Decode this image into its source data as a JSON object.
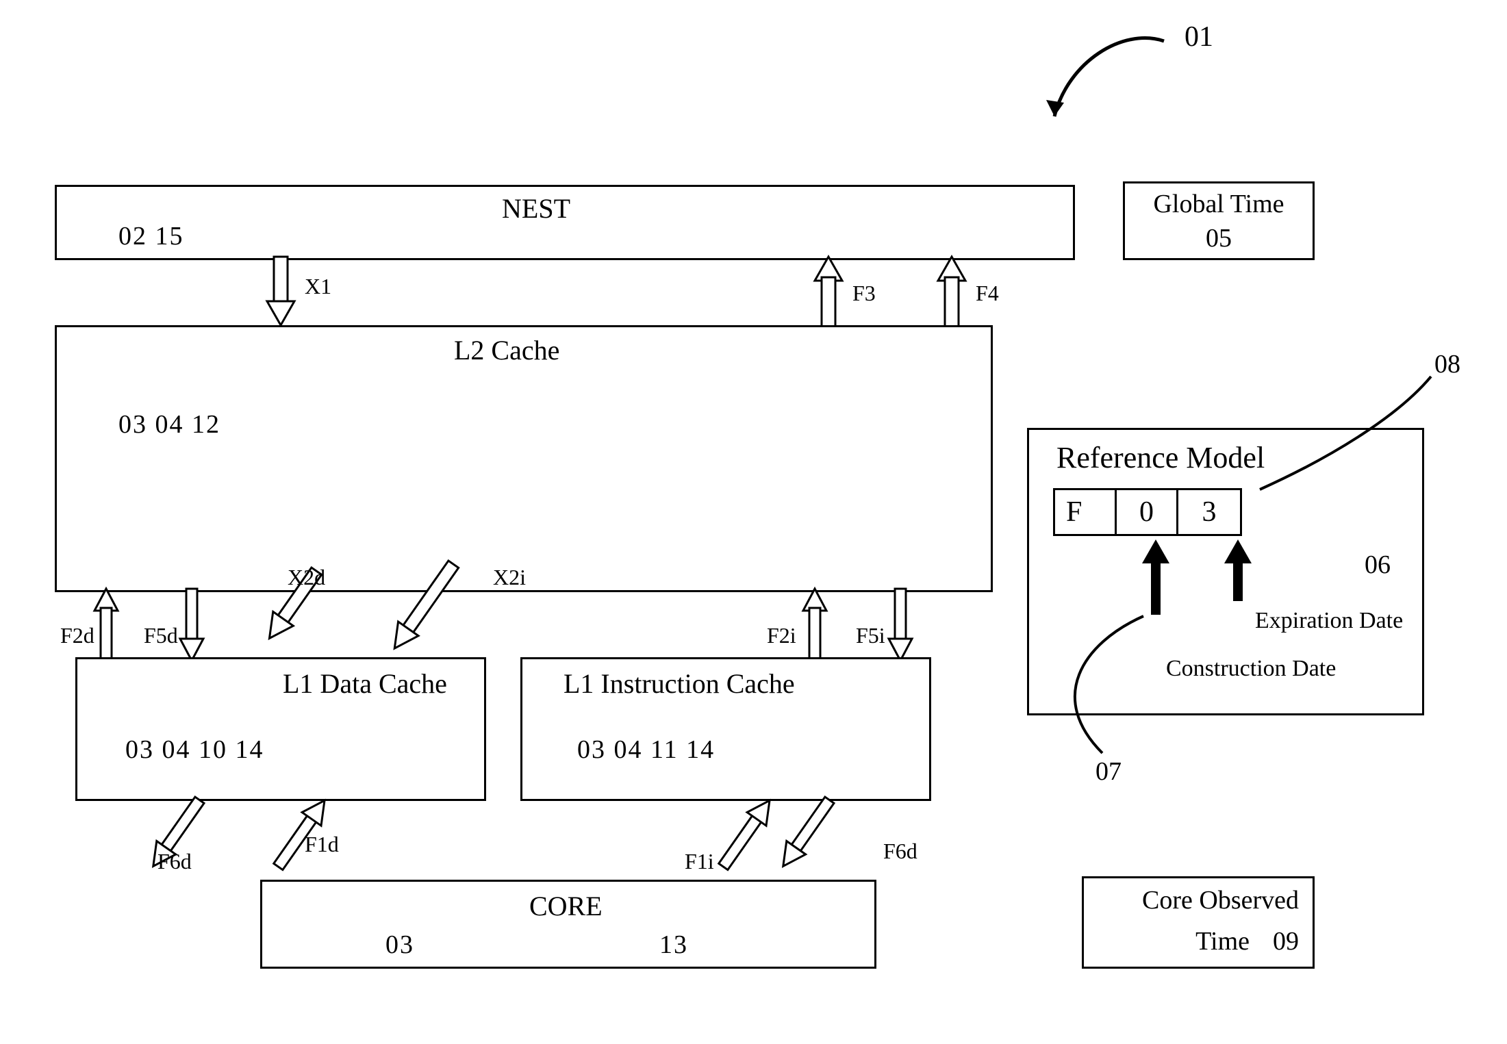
{
  "callout_01": "01",
  "nest": {
    "title": "NEST",
    "nums": "02   15"
  },
  "l2": {
    "title": "L2 Cache",
    "nums": "03   04   12"
  },
  "l1d": {
    "title": "L1 Data Cache",
    "nums": "03   04   10   14"
  },
  "l1i": {
    "title": "L1 Instruction Cache",
    "nums": "03   04   11   14"
  },
  "core": {
    "title": "CORE",
    "nums_left": "03",
    "nums_right": "13"
  },
  "global_time": {
    "line1": "Global Time",
    "line2": "05"
  },
  "core_observed": {
    "line1": "Core Observed",
    "line2a": "Time",
    "line2b": "09"
  },
  "ref_model": {
    "title": "Reference Model",
    "cells": {
      "a": "F",
      "b": "0",
      "c": "3"
    },
    "callout_06": "06",
    "callout_07": "07",
    "callout_08": "08",
    "construction": "Construction Date",
    "expiration": "Expiration Date"
  },
  "arrows": {
    "X1": "X1",
    "X2d": "X2d",
    "X2i": "X2i",
    "F1d": "F1d",
    "F1i": "F1i",
    "F2d": "F2d",
    "F2i": "F2i",
    "F3": "F3",
    "F4": "F4",
    "F5d": "F5d",
    "F5i": "F5i",
    "F6d_left": "F6d",
    "F6d_right": "F6d"
  }
}
